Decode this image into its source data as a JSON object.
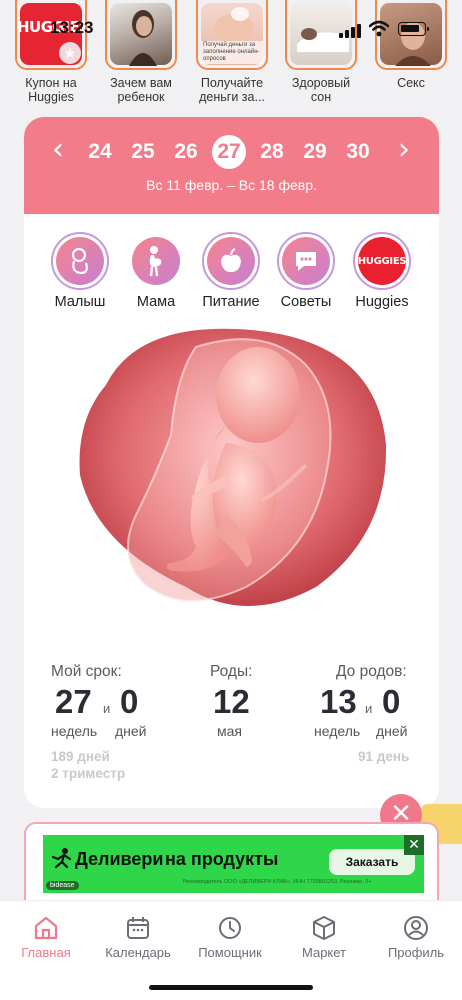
{
  "status_bar": {
    "time": "13:23"
  },
  "stories": [
    {
      "caption": "Купон на Huggies",
      "logo_text": "HUGGIES"
    },
    {
      "caption": "Зачем вам ребенок"
    },
    {
      "caption": "Получайте деньги за...",
      "overlay_text": "Получай деньги за заполнение онлайн-опросов"
    },
    {
      "caption": "Здоровый сон"
    },
    {
      "caption": "Секс"
    }
  ],
  "week_selector": {
    "weeks": [
      "24",
      "25",
      "26",
      "27",
      "28",
      "29",
      "30"
    ],
    "selected": "27",
    "date_range": "Вс 11 февр. – Вс 18 февр."
  },
  "categories": [
    {
      "label": "Малыш",
      "icon": "baby-icon"
    },
    {
      "label": "Мама",
      "icon": "pregnant-icon"
    },
    {
      "label": "Питание",
      "icon": "apple-icon"
    },
    {
      "label": "Советы",
      "icon": "chat-icon"
    },
    {
      "label": "Huggies",
      "icon": "huggies-logo",
      "logo_text": "HUGGIES"
    }
  ],
  "stats": {
    "term_label": "Мой срок:",
    "term_weeks": "27",
    "term_and": "и",
    "term_days": "0",
    "weeks_unit": "недель",
    "days_unit": "дней",
    "birth_label": "Роды:",
    "birth_day": "12",
    "birth_month": "мая",
    "until_label": "До родов:",
    "until_weeks": "13",
    "until_and": "и",
    "until_days": "0",
    "until_weeks_unit": "недель",
    "until_days_unit": "дней",
    "total_days": "189 дней",
    "trimester": "2 триместр",
    "remaining_days": "91 день"
  },
  "ad": {
    "brand": "Деливери",
    "tagline": "на продукты",
    "cta": "Заказать",
    "legal": "Рекламодатель ООО «ДЕЛИВЕРИ КЛАБ», ИНН 7705891253, Реклама. 0+",
    "network": "bidease"
  },
  "tabs": [
    {
      "label": "Главная",
      "icon": "home-icon",
      "active": true
    },
    {
      "label": "Календарь",
      "icon": "calendar-icon",
      "active": false
    },
    {
      "label": "Помощник",
      "icon": "clock-icon",
      "active": false
    },
    {
      "label": "Маркет",
      "icon": "box-icon",
      "active": false
    },
    {
      "label": "Профиль",
      "icon": "profile-icon",
      "active": false
    }
  ],
  "colors": {
    "accent": "#f27c8a",
    "ring": "#c69ad8",
    "ad_green": "#2fd64a",
    "story_border": "#f08a4b"
  }
}
